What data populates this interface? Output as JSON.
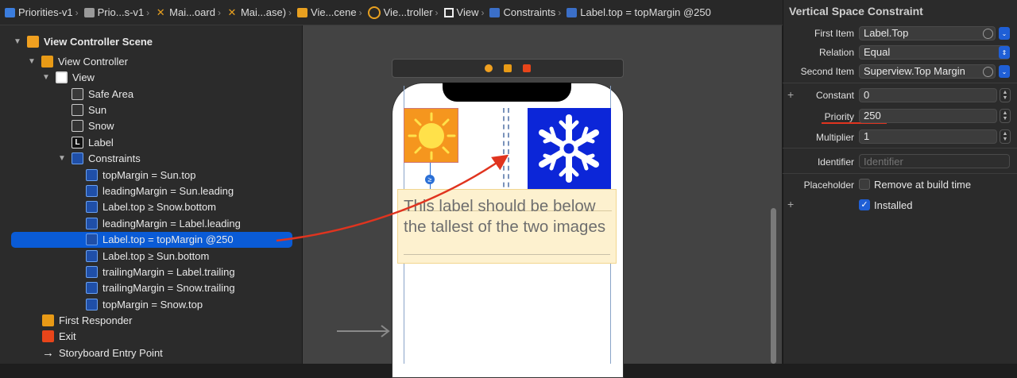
{
  "breadcrumb": [
    {
      "label": "Priorities-v1",
      "icon": "project-icon"
    },
    {
      "label": "Prio...s-v1",
      "icon": "folder-icon"
    },
    {
      "label": "Mai...oard",
      "icon": "storyboard-icon"
    },
    {
      "label": "Mai...ase)",
      "icon": "storyboard-icon"
    },
    {
      "label": "Vie...cene",
      "icon": "scene-icon"
    },
    {
      "label": "Vie...troller",
      "icon": "view-controller-icon"
    },
    {
      "label": "View",
      "icon": "view-icon"
    },
    {
      "label": "Constraints",
      "icon": "constraints-icon"
    },
    {
      "label": "Label.top = topMargin @250",
      "icon": "constraint-icon"
    }
  ],
  "outline": {
    "scene": "View Controller Scene",
    "view_controller": "View Controller",
    "view": "View",
    "safe_area": "Safe Area",
    "sun": "Sun",
    "snow": "Snow",
    "label": "Label",
    "constraints": "Constraints",
    "constraint_items": [
      "topMargin = Sun.top",
      "leadingMargin = Sun.leading",
      "Label.top ≥ Snow.bottom",
      "leadingMargin = Label.leading",
      "Label.top = topMargin @250",
      "Label.top ≥ Sun.bottom",
      "trailingMargin = Label.trailing",
      "trailingMargin = Snow.trailing",
      "topMargin = Snow.top"
    ],
    "selected_index": 4,
    "first_responder": "First Responder",
    "exit": "Exit",
    "entry_point": "Storyboard Entry Point"
  },
  "canvas": {
    "label_text": "This label should be below the tallest of the two images",
    "ge_badge": "≥"
  },
  "inspector": {
    "title": "Vertical Space Constraint",
    "first_item_label": "First Item",
    "first_item_value": "Label.Top",
    "relation_label": "Relation",
    "relation_value": "Equal",
    "second_item_label": "Second Item",
    "second_item_value": "Superview.Top Margin",
    "constant_label": "Constant",
    "constant_value": "0",
    "priority_label": "Priority",
    "priority_value": "250",
    "multiplier_label": "Multiplier",
    "multiplier_value": "1",
    "identifier_label": "Identifier",
    "identifier_placeholder": "Identifier",
    "placeholder_label": "Placeholder",
    "remove_at_build_label": "Remove at build time",
    "remove_at_build_checked": false,
    "installed_label": "Installed",
    "installed_checked": true
  },
  "colors": {
    "selection": "#0a5bd6",
    "annotation_red": "#e0341f",
    "sun_bg": "#f5961e",
    "snow_bg": "#0c26d8",
    "label_bg": "#fdf1cf"
  }
}
